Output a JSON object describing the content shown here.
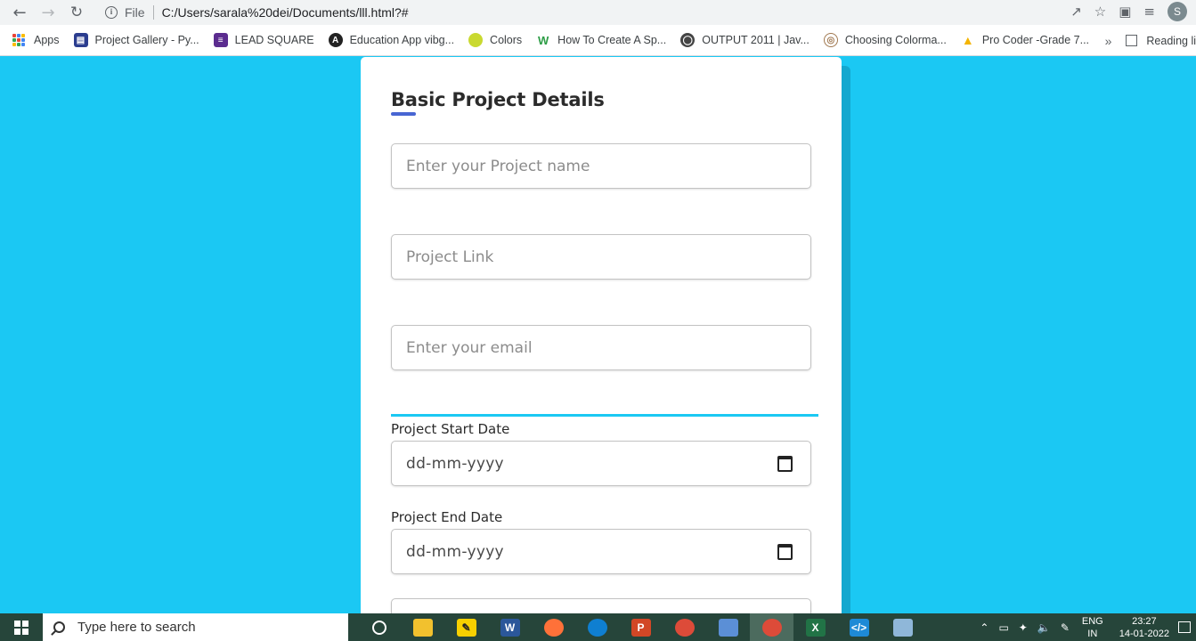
{
  "browser": {
    "file_label": "File",
    "url": "C:/Users/sarala%20dei/Documents/lll.html?#",
    "avatar_letter": "S"
  },
  "bookmarks": [
    {
      "label": "Apps",
      "icon": "apps-grid-icon",
      "color": "#4285f4"
    },
    {
      "label": "Project Gallery - Py...",
      "icon": "project-gallery-icon",
      "color": "#2b3d8f"
    },
    {
      "label": "LEAD SQUARE",
      "icon": "lead-square-icon",
      "color": "#5b2c8f"
    },
    {
      "label": "Education App vibg...",
      "icon": "angular-icon",
      "color": "#222222"
    },
    {
      "label": "Colors",
      "icon": "colors-icon",
      "color": "#c9d930"
    },
    {
      "label": "How To Create A Sp...",
      "icon": "wix-icon",
      "color": "#2d9d46"
    },
    {
      "label": "OUTPUT 2011 | Jav...",
      "icon": "globe-icon",
      "color": "#444444"
    },
    {
      "label": "Choosing Colorma...",
      "icon": "colormap-icon",
      "color": "#a07850"
    },
    {
      "label": "Pro Coder -Grade 7...",
      "icon": "google-drive-icon",
      "color": "#f4b400"
    }
  ],
  "bookmarks_more": "»",
  "reading_list": "Reading li",
  "form": {
    "title": "Basic Project Details",
    "project_name_placeholder": "Enter your Project name",
    "project_link_placeholder": "Project Link",
    "email_placeholder": "Enter your email",
    "start_date_label": "Project Start Date",
    "start_date_value": "dd-mm-yyyy",
    "end_date_label": "Project End Date",
    "end_date_value": "dd-mm-yyyy"
  },
  "taskbar": {
    "search_placeholder": "Type here to search",
    "apps": [
      {
        "name": "task-view",
        "color": "#ffffff"
      },
      {
        "name": "file-explorer",
        "color": "#f2c12e"
      },
      {
        "name": "sticky-notes",
        "color": "#f7d000"
      },
      {
        "name": "word",
        "color": "#2b579a",
        "letter": "W"
      },
      {
        "name": "firefox",
        "color": "#ff7139"
      },
      {
        "name": "edge",
        "color": "#0f7fd1"
      },
      {
        "name": "powerpoint",
        "color": "#d24726",
        "letter": "P"
      },
      {
        "name": "chrome",
        "color": "#dd4b39"
      },
      {
        "name": "control-panel",
        "color": "#5b8fd6"
      },
      {
        "name": "chrome-active",
        "color": "#dd4b39"
      },
      {
        "name": "excel",
        "color": "#217346",
        "letter": "X"
      },
      {
        "name": "vscode",
        "color": "#1e8ad6"
      },
      {
        "name": "notepad",
        "color": "#8fb7d9"
      }
    ],
    "lang_top": "ENG",
    "lang_bottom": "IN",
    "time": "23:27",
    "date": "14-01-2022"
  }
}
